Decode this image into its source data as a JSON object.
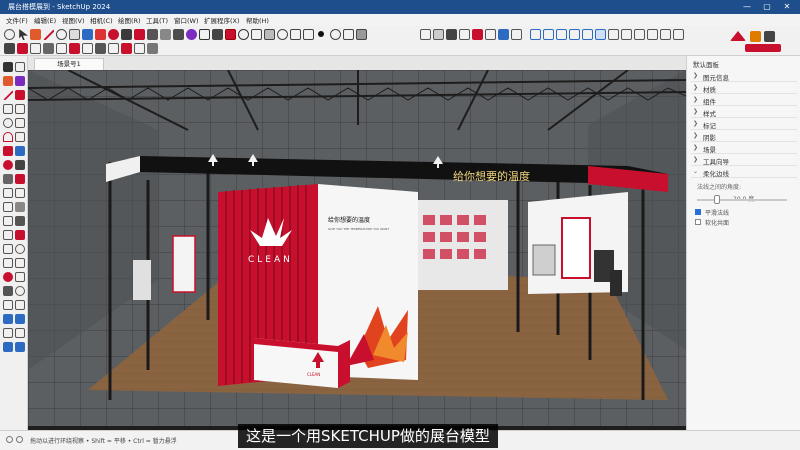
{
  "window": {
    "title": "展台搭模展到 - SketchUp 2024",
    "controls": {
      "minimize": "—",
      "maximize": "▢",
      "close": "✕"
    }
  },
  "menu": [
    "文件(F)",
    "编辑(E)",
    "视图(V)",
    "相机(C)",
    "绘图(R)",
    "工具(T)",
    "窗口(W)",
    "扩展程序(X)",
    "帮助(H)"
  ],
  "scene_tab": "场景号1",
  "tray": {
    "title": "默认面板",
    "sections": [
      "图元信息",
      "材质",
      "组件",
      "样式",
      "标记",
      "阴影",
      "场景",
      "工具向导",
      "柔化边线"
    ],
    "softening": {
      "angle_label": "法线之间的角度:",
      "angle_value": "20.0 度",
      "angle_fraction": 0.22,
      "smooth_normals_label": "平滑法线",
      "smooth_normals_checked": true,
      "soften_coplanar_label": "软化共面",
      "soften_coplanar_checked": false
    }
  },
  "model": {
    "brand_text": "CLEAN",
    "header_slogan": "给你想要的温度",
    "panel_heading": "给你想要的温度",
    "panel_subtitle": "GIVE YOU THE TEMPERATURE YOU WANT"
  },
  "status": "拖动以进行环绕视察 • Shift = 平移 • Ctrl = 暂力悬浮",
  "subtitle": "这是一个用SKETCHUP做的展台模型",
  "colors": {
    "accent_red": "#c8102e",
    "titlebar_blue": "#1f4e8c",
    "floor_wood": "#8a6440",
    "booth_white": "#f4f4f4"
  }
}
